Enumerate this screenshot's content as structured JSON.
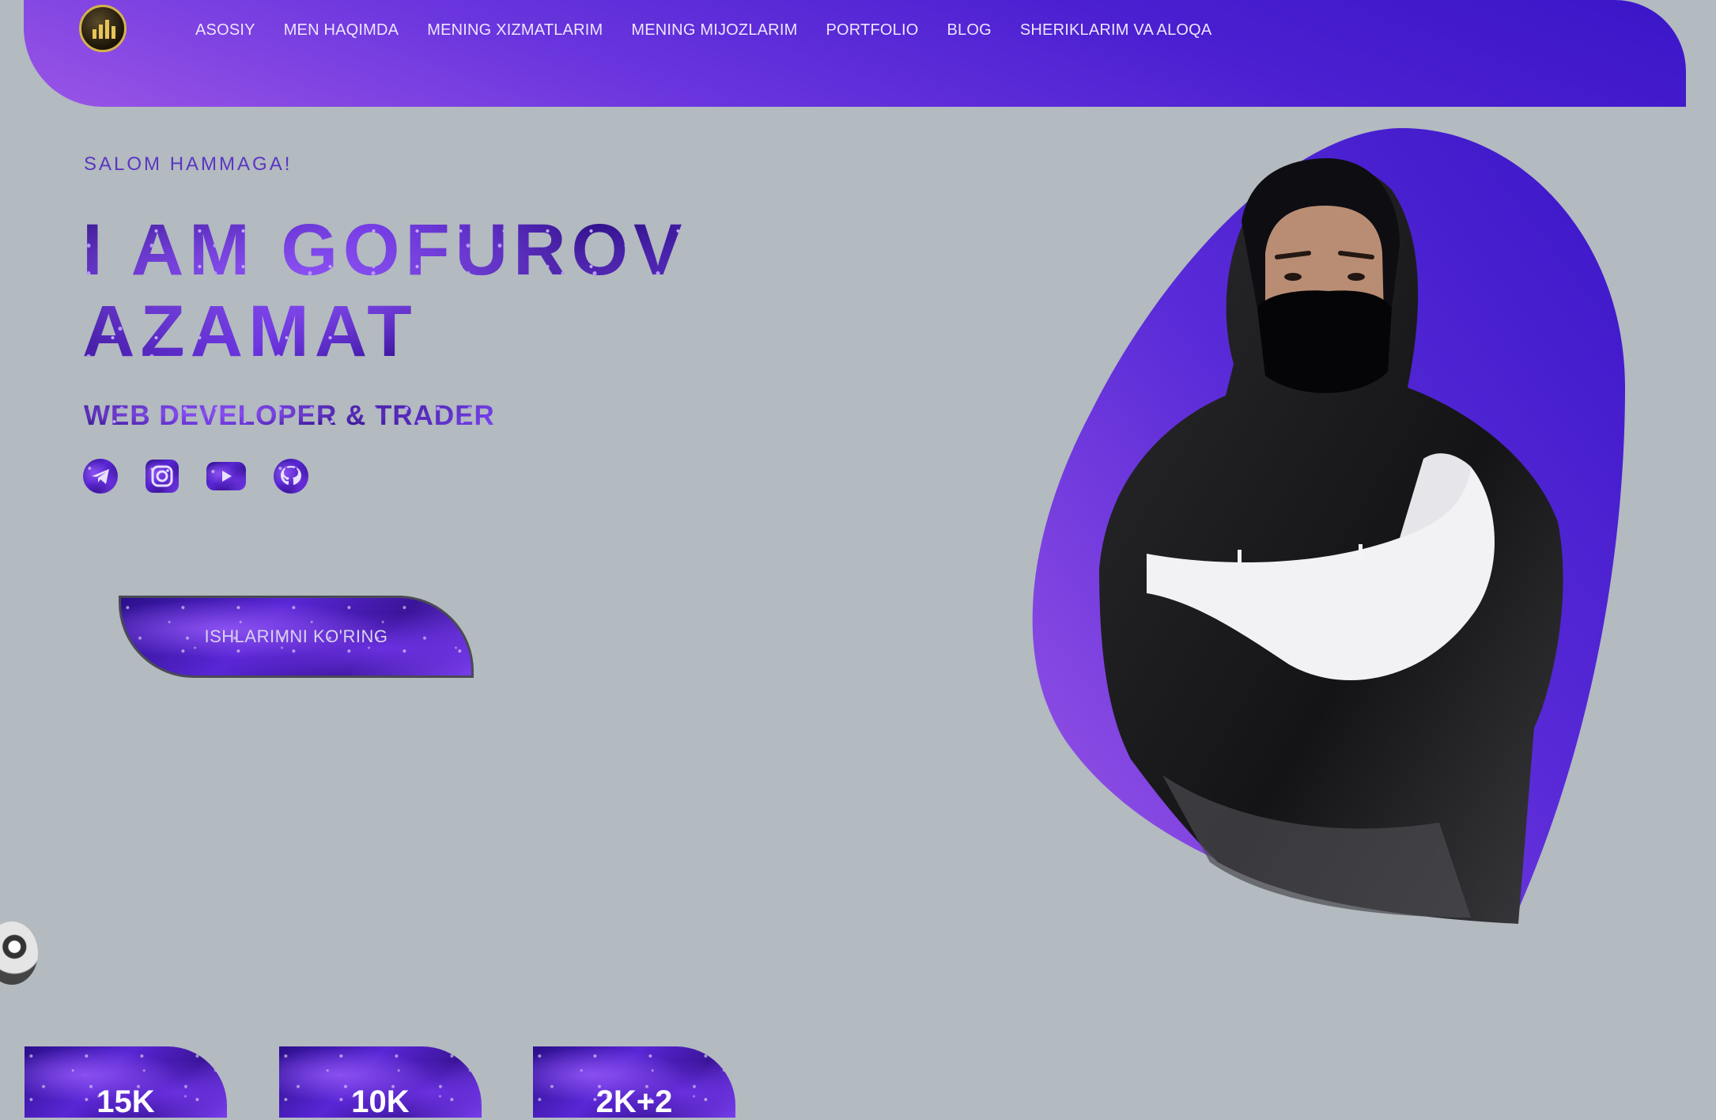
{
  "nav": {
    "logo_icon": "trading-chart-logo-icon",
    "items": [
      {
        "label": "ASOSIY"
      },
      {
        "label": "MEN HAQIMDA"
      },
      {
        "label": "MENING XIZMATLARIM"
      },
      {
        "label": "MENING MIJOZLARIM"
      },
      {
        "label": "PORTFOLIO"
      },
      {
        "label": "BLOG"
      },
      {
        "label": "SHERIKLARIM VA ALOQA"
      }
    ]
  },
  "hero": {
    "greeting": "SALOM HAMMAGA!",
    "title_line1": "I AM GOFUROV",
    "title_line2": "AZAMAT",
    "subtitle": "WEB DEVELOPER & TRADER",
    "socials": [
      {
        "icon": "telegram-icon"
      },
      {
        "icon": "instagram-icon"
      },
      {
        "icon": "youtube-icon"
      },
      {
        "icon": "github-icon"
      }
    ],
    "cta_label": "ISHLARIMNI KO'RING"
  },
  "colors": {
    "accent": "#5a26d6",
    "header_start": "#9a55e6",
    "header_end": "#3a16c8",
    "background": "#b3bac0"
  },
  "stats": [
    {
      "value": "15K"
    },
    {
      "value": "10K"
    },
    {
      "value": "2K+2"
    }
  ]
}
